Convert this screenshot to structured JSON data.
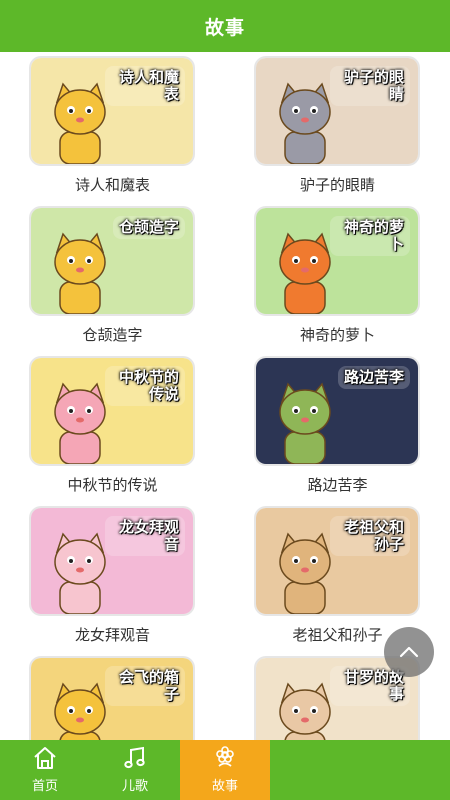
{
  "header": {
    "title": "故事"
  },
  "stories": [
    {
      "caption": "诗人和魔表",
      "badge": "诗人和魔表",
      "bg": "#f5e6a8",
      "accent": "#f4c23c"
    },
    {
      "caption": "驴子的眼睛",
      "badge": "驴子的眼睛",
      "bg": "#e8d7c4",
      "accent": "#9a9aa6"
    },
    {
      "caption": "仓颉造字",
      "badge": "仓颉造字",
      "bg": "#cfe7a8",
      "accent": "#f4c23c"
    },
    {
      "caption": "神奇的萝卜",
      "badge": "神奇的萝卜",
      "bg": "#bde39b",
      "accent": "#f07a2f"
    },
    {
      "caption": "中秋节的传说",
      "badge": "中秋节的传说",
      "bg": "#f7e38a",
      "accent": "#f5a6b6"
    },
    {
      "caption": "路边苦李",
      "badge": "路边苦李",
      "bg": "#2c3554",
      "accent": "#8fb657"
    },
    {
      "caption": "龙女拜观音",
      "badge": "龙女拜观音",
      "bg": "#f3b9d6",
      "accent": "#f7c5cf"
    },
    {
      "caption": "老祖父和孙子",
      "badge": "老祖父和孙子",
      "bg": "#e9c9a0",
      "accent": "#e0b47c"
    },
    {
      "caption": "",
      "badge": "会飞的箱子",
      "bg": "#f4d57c",
      "accent": "#f4c23c"
    },
    {
      "caption": "",
      "badge": "甘罗的故事",
      "bg": "#f1e2c9",
      "accent": "#e9c8a5"
    }
  ],
  "tabs": [
    {
      "label": "首页",
      "icon": "home-icon",
      "active": false
    },
    {
      "label": "儿歌",
      "icon": "music-note-icon",
      "active": false
    },
    {
      "label": "故事",
      "icon": "flower-icon",
      "active": true
    },
    {
      "label": "",
      "icon": "",
      "active": false
    }
  ],
  "colors": {
    "primary": "#5db829",
    "active_tab": "#f4a71b"
  },
  "scroll_top_icon": "chevron-up-icon"
}
